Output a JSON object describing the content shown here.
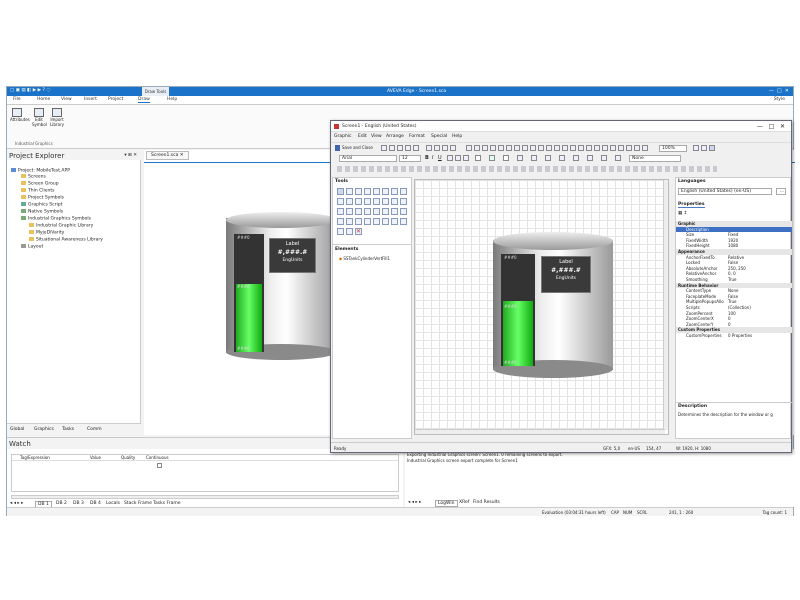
{
  "app": {
    "title": "AVEVA Edge - Screen1.sca",
    "tabs": [
      "File",
      "Home",
      "View",
      "Insert",
      "Project",
      "Draw",
      "Help"
    ],
    "context_tab": "Draw Tools",
    "style_label": "Style",
    "ribbon_buttons": [
      "Attributes",
      "Edit Symbol",
      "Import Library"
    ],
    "ribbon_group": "Industrial Graphics"
  },
  "explorer": {
    "title": "Project Explorer",
    "items": [
      "Project: MobileTest.APP",
      "Screens",
      "Screen Group",
      "Thin Clients",
      "Project Symbols",
      "Graphics Script",
      "Native Symbols",
      "Industrial Graphics Symbols",
      "Industrial Graphic Library",
      "MyjeDiVarity",
      "Situational Awareness Library",
      "Layout"
    ],
    "bottom_tabs": [
      "Global",
      "Graphics",
      "Tasks",
      "Comm"
    ]
  },
  "doc_tab": "Screen1.sca",
  "watch": {
    "title": "Watch",
    "columns": [
      "Tag/Expression",
      "Value",
      "Quality",
      "Continuous"
    ],
    "tabs": [
      "DB 1",
      "DB 2",
      "DB 3",
      "DB 4",
      "Locals",
      "Stack Frame",
      "Tasks Frame"
    ]
  },
  "output": {
    "lines": [
      "Exporting Industrial Graphics screen: Screen1. 0 remaining screens to export.",
      "Industrial Graphics screen export complete for Screen1"
    ],
    "tabs": [
      "LogWin",
      "XRef",
      "Find Results"
    ]
  },
  "status": {
    "evaluation": "Evaluation (03:04:31 hours left)",
    "caps": "CAP",
    "num": "NUM",
    "scrl": "SCRL",
    "coords": "241, 1 : 260",
    "tag_count": "Tag count: 1"
  },
  "symbol": {
    "label": "Label",
    "value": "#,###.#",
    "units": "EngUnits",
    "tick": "###0",
    "level": 0.58
  },
  "editor": {
    "title": "Screen1 - English (United States)",
    "menu": [
      "Graphic",
      "Edit",
      "View",
      "Arrange",
      "Format",
      "Special",
      "Help"
    ],
    "save_close": "Save and Close",
    "zoom": "100%",
    "font": "Arial",
    "font_size": "12",
    "fill_none": "None",
    "tools_title": "Tools",
    "elements_title": "Elements",
    "element_item": "SSTankCylinderVertFill1",
    "status_ready": "Ready",
    "status_gfx": "GFX: 5,0",
    "status_lang": "en-US",
    "status_pos": "154, 47",
    "status_size": "W: 1920, H: 1080",
    "languages_title": "Languages",
    "language": "English (United States) (en-US)",
    "properties_title": "Properties",
    "description_title": "Description",
    "description_text": "Determines the description for the window or g"
  },
  "properties": [
    {
      "section": "Graphic"
    },
    {
      "k": "Description",
      "v": "",
      "sel": true
    },
    {
      "k": "Size",
      "v": "Fixed"
    },
    {
      "k": "FixedWidth",
      "v": "1920"
    },
    {
      "k": "FixedHeight",
      "v": "1080"
    },
    {
      "section": "Appearance"
    },
    {
      "k": "AnchorFixedTo",
      "v": "Relative"
    },
    {
      "k": "Locked",
      "v": "False"
    },
    {
      "k": "AbsoluteAnchor",
      "v": "250, 250"
    },
    {
      "k": "RelativeAnchor",
      "v": "0, 0"
    },
    {
      "k": "Smoothing",
      "v": "True"
    },
    {
      "section": "Runtime Behavior"
    },
    {
      "k": "ContentType",
      "v": "None"
    },
    {
      "k": "FaceplateMode",
      "v": "False"
    },
    {
      "k": "MultiplePopupsAllo",
      "v": "True"
    },
    {
      "k": "Scripts",
      "v": "(Collection)"
    },
    {
      "k": "ZoomPercent",
      "v": "100"
    },
    {
      "k": "ZoomCenterX",
      "v": "0"
    },
    {
      "k": "ZoomCenterY",
      "v": "0"
    },
    {
      "section": "Custom Properties"
    },
    {
      "k": "CustomProperties",
      "v": "0 Properties"
    }
  ]
}
